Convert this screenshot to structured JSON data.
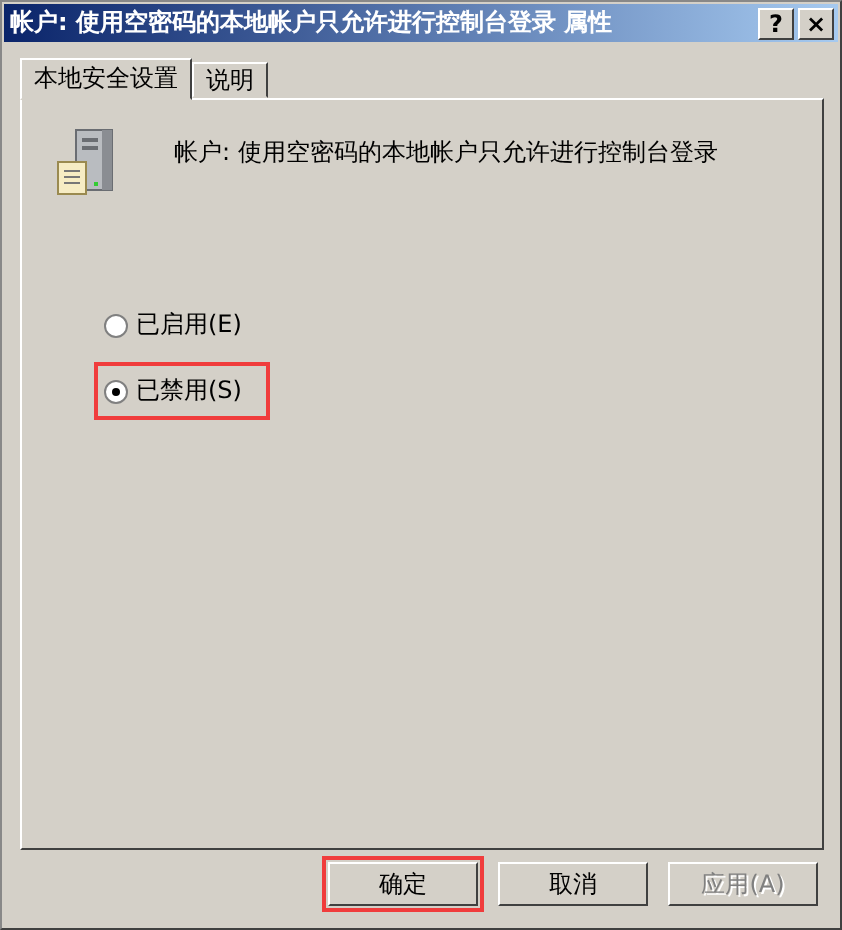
{
  "window": {
    "title": "帐户: 使用空密码的本地帐户只允许进行控制台登录 属性",
    "help_button": "?",
    "close_button": "×"
  },
  "tabs": [
    {
      "label": "本地安全设置",
      "selected": true
    },
    {
      "label": "说明",
      "selected": false
    }
  ],
  "policy": {
    "name": "帐户:  使用空密码的本地帐户只允许进行控制台登录"
  },
  "options": [
    {
      "label": "已启用(E)",
      "selected": false,
      "highlighted": false
    },
    {
      "label": "已禁用(S)",
      "selected": true,
      "highlighted": true
    }
  ],
  "buttons": [
    {
      "label": "确定",
      "disabled": false,
      "highlighted": true
    },
    {
      "label": "取消",
      "disabled": false,
      "highlighted": false
    },
    {
      "label": "应用(A)",
      "disabled": true,
      "highlighted": false
    }
  ]
}
